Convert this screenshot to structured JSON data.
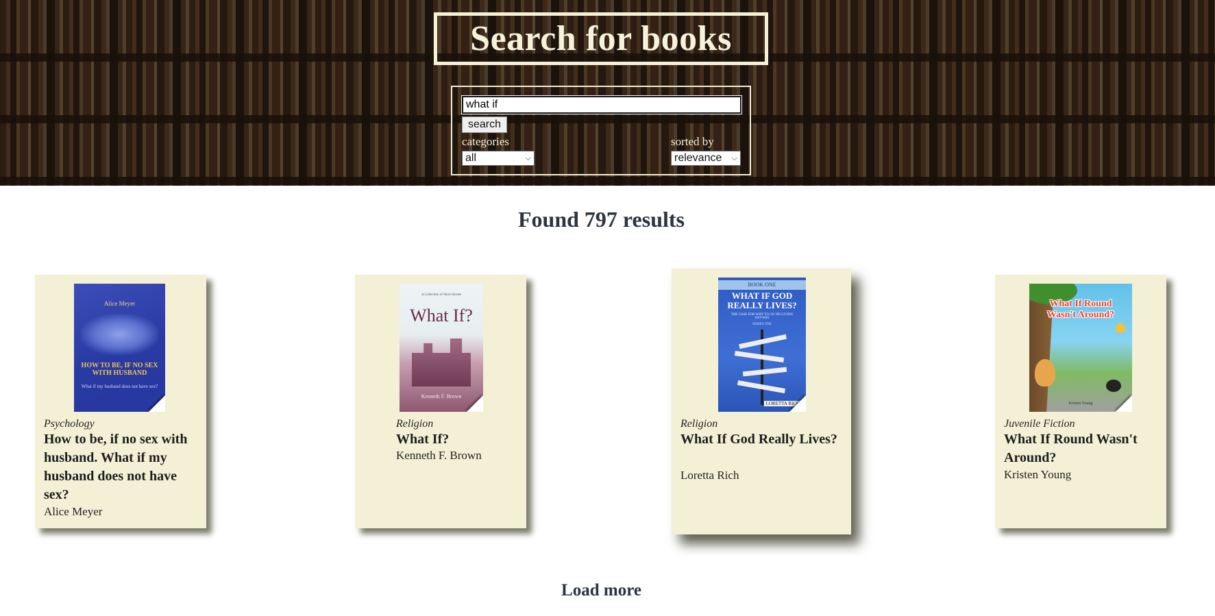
{
  "header": {
    "title": "Search for books",
    "search_value": "what if",
    "search_button": "search",
    "categories_label": "categories",
    "categories_value": "all",
    "sorted_label": "sorted by",
    "sorted_value": "relevance"
  },
  "results": {
    "summary": "Found 797 results",
    "load_more": "Load more",
    "books": [
      {
        "category": "Psychology",
        "title": "How to be, if no sex with husband. What if my husband does not have sex?",
        "author": "Alice Meyer",
        "cover": {
          "top": "Alice Meyer",
          "main": "HOW TO BE, IF NO SEX WITH HUSBAND",
          "sub": "What if my husband does not have sex?",
          "color": "#2a3aa4"
        }
      },
      {
        "category": "Religion",
        "title": "What If?",
        "author": "Kenneth F. Brown",
        "cover": {
          "top": "A Collection of Short Stories",
          "main": "What If?",
          "sub": "Kenneth F. Brown",
          "color": "#7a3b5a"
        }
      },
      {
        "category": "Religion",
        "title": "What If God Really Lives?",
        "author": "Loretta Rich",
        "cover": {
          "top": "BOOK ONE",
          "main": "WHAT IF GOD REALLY LIVES?",
          "sub": "THE CASE FOR WHY TO GO ON LIVING ANYWAY",
          "series": "SERIES ONE",
          "bottom": "LORETTA RICH",
          "color": "#2f5bc3"
        }
      },
      {
        "category": "Juvenile Fiction",
        "title": "What If Round Wasn't Around?",
        "author": "Kristen Young",
        "cover": {
          "main": "What If Round Wasn't Around?",
          "bottom": "Kristen Young",
          "color": "#63c0ea"
        }
      }
    ]
  }
}
